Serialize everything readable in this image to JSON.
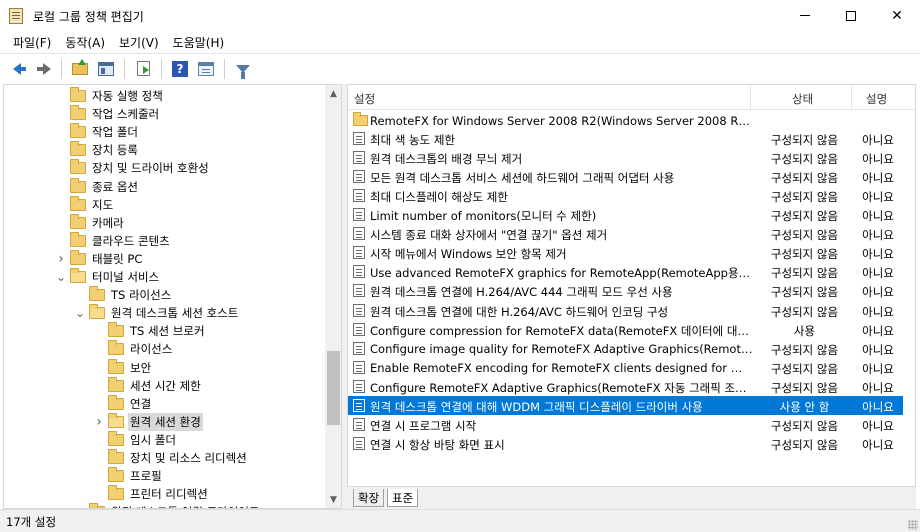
{
  "window": {
    "title": "로컬 그룹 정책 편집기"
  },
  "menu": [
    "파일(F)",
    "동작(A)",
    "보기(V)",
    "도움말(H)"
  ],
  "toolbar": {
    "buttons": [
      "back-icon",
      "forward-icon",
      "up-folder-icon",
      "show-hide-console-tree-icon",
      "export-list-icon",
      "help-icon",
      "properties-icon",
      "filter-icon"
    ]
  },
  "tree": [
    {
      "label": "자동 실행 정책",
      "level": 0,
      "expander": ""
    },
    {
      "label": "작업 스케줄러",
      "level": 0,
      "expander": ""
    },
    {
      "label": "작업 폴더",
      "level": 0,
      "expander": ""
    },
    {
      "label": "장치 등록",
      "level": 0,
      "expander": ""
    },
    {
      "label": "장치 및 드라이버 호환성",
      "level": 0,
      "expander": ""
    },
    {
      "label": "종료 옵션",
      "level": 0,
      "expander": ""
    },
    {
      "label": "지도",
      "level": 0,
      "expander": ""
    },
    {
      "label": "카메라",
      "level": 0,
      "expander": ""
    },
    {
      "label": "클라우드 콘텐츠",
      "level": 0,
      "expander": ""
    },
    {
      "label": "태블릿 PC",
      "level": 0,
      "expander": ">"
    },
    {
      "label": "터미널 서비스",
      "level": 0,
      "expander": "v"
    },
    {
      "label": "TS 라이선스",
      "level": 1,
      "expander": ""
    },
    {
      "label": "원격 데스크톱 세션 호스트",
      "level": 1,
      "expander": "v"
    },
    {
      "label": "TS 세션 브로커",
      "level": 2,
      "expander": ""
    },
    {
      "label": "라이선스",
      "level": 2,
      "expander": ""
    },
    {
      "label": "보안",
      "level": 2,
      "expander": ""
    },
    {
      "label": "세션 시간 제한",
      "level": 2,
      "expander": ""
    },
    {
      "label": "연결",
      "level": 2,
      "expander": ""
    },
    {
      "label": "원격 세션 환경",
      "level": 2,
      "expander": ">"
    },
    {
      "label": "임시 폴더",
      "level": 2,
      "expander": ""
    },
    {
      "label": "장치 및 리소스 리디렉션",
      "level": 2,
      "expander": ""
    },
    {
      "label": "프로필",
      "level": 2,
      "expander": ""
    },
    {
      "label": "프린터 리디렉션",
      "level": 2,
      "expander": ""
    },
    {
      "label": "원격 데스크톱 연결 클라이언트",
      "level": 1,
      "expander": ""
    }
  ],
  "tree_selected_index": 18,
  "list": {
    "columns": [
      "설정",
      "상태",
      "설명"
    ],
    "rows": [
      {
        "name": "RemoteFX for Windows Server 2008 R2(Windows Server 2008 R2용 ...",
        "state": "",
        "comment": "",
        "type": "folder"
      },
      {
        "name": "최대 색 농도 제한",
        "state": "구성되지 않음",
        "comment": "아니요",
        "type": "setting"
      },
      {
        "name": "원격 데스크톱의 배경 무늬 제거",
        "state": "구성되지 않음",
        "comment": "아니요",
        "type": "setting"
      },
      {
        "name": "모든 원격 데스크톱 서비스 세션에 하드웨어 그래픽 어댑터 사용",
        "state": "구성되지 않음",
        "comment": "아니요",
        "type": "setting"
      },
      {
        "name": "최대 디스플레이 해상도 제한",
        "state": "구성되지 않음",
        "comment": "아니요",
        "type": "setting"
      },
      {
        "name": "Limit number of monitors(모니터 수 제한)",
        "state": "구성되지 않음",
        "comment": "아니요",
        "type": "setting"
      },
      {
        "name": "시스템 종료 대화 상자에서 \"연결 끊기\" 옵션 제거",
        "state": "구성되지 않음",
        "comment": "아니요",
        "type": "setting"
      },
      {
        "name": "시작 메뉴에서 Windows 보안 항목 제거",
        "state": "구성되지 않음",
        "comment": "아니요",
        "type": "setting"
      },
      {
        "name": "Use advanced RemoteFX graphics for RemoteApp(RemoteApp용 고...",
        "state": "구성되지 않음",
        "comment": "아니요",
        "type": "setting"
      },
      {
        "name": "원격 데스크톱 연결에 H.264/AVC 444 그래픽 모드 우선 사용",
        "state": "구성되지 않음",
        "comment": "아니요",
        "type": "setting"
      },
      {
        "name": "원격 데스크톱 연결에 대한 H.264/AVC 하드웨어 인코딩 구성",
        "state": "구성되지 않음",
        "comment": "아니요",
        "type": "setting"
      },
      {
        "name": "Configure compression for RemoteFX data(RemoteFX 데이터에 대해 ...",
        "state": "사용",
        "comment": "아니요",
        "type": "setting"
      },
      {
        "name": "Configure image quality for RemoteFX Adaptive Graphics(RemoteFX ...",
        "state": "구성되지 않음",
        "comment": "아니요",
        "type": "setting"
      },
      {
        "name": "Enable RemoteFX encoding for RemoteFX clients designed for Windo...",
        "state": "구성되지 않음",
        "comment": "아니요",
        "type": "setting"
      },
      {
        "name": "Configure RemoteFX Adaptive Graphics(RemoteFX 자동 그래픽 조정 ...",
        "state": "구성되지 않음",
        "comment": "아니요",
        "type": "setting"
      },
      {
        "name": "원격 데스크톱 연결에 대해 WDDM 그래픽 디스플레이 드라이버 사용",
        "state": "사용 안 함",
        "comment": "아니요",
        "type": "setting"
      },
      {
        "name": "연결 시 프로그램 시작",
        "state": "구성되지 않음",
        "comment": "아니요",
        "type": "setting"
      },
      {
        "name": "연결 시 항상 바탕 화면 표시",
        "state": "구성되지 않음",
        "comment": "아니요",
        "type": "setting"
      }
    ],
    "selected_index": 15
  },
  "tabs": [
    "확장",
    "표준"
  ],
  "status": {
    "text": "17개 설정"
  },
  "colors": {
    "selection": "#0078d7",
    "tree_selection": "#d9d9d9"
  }
}
